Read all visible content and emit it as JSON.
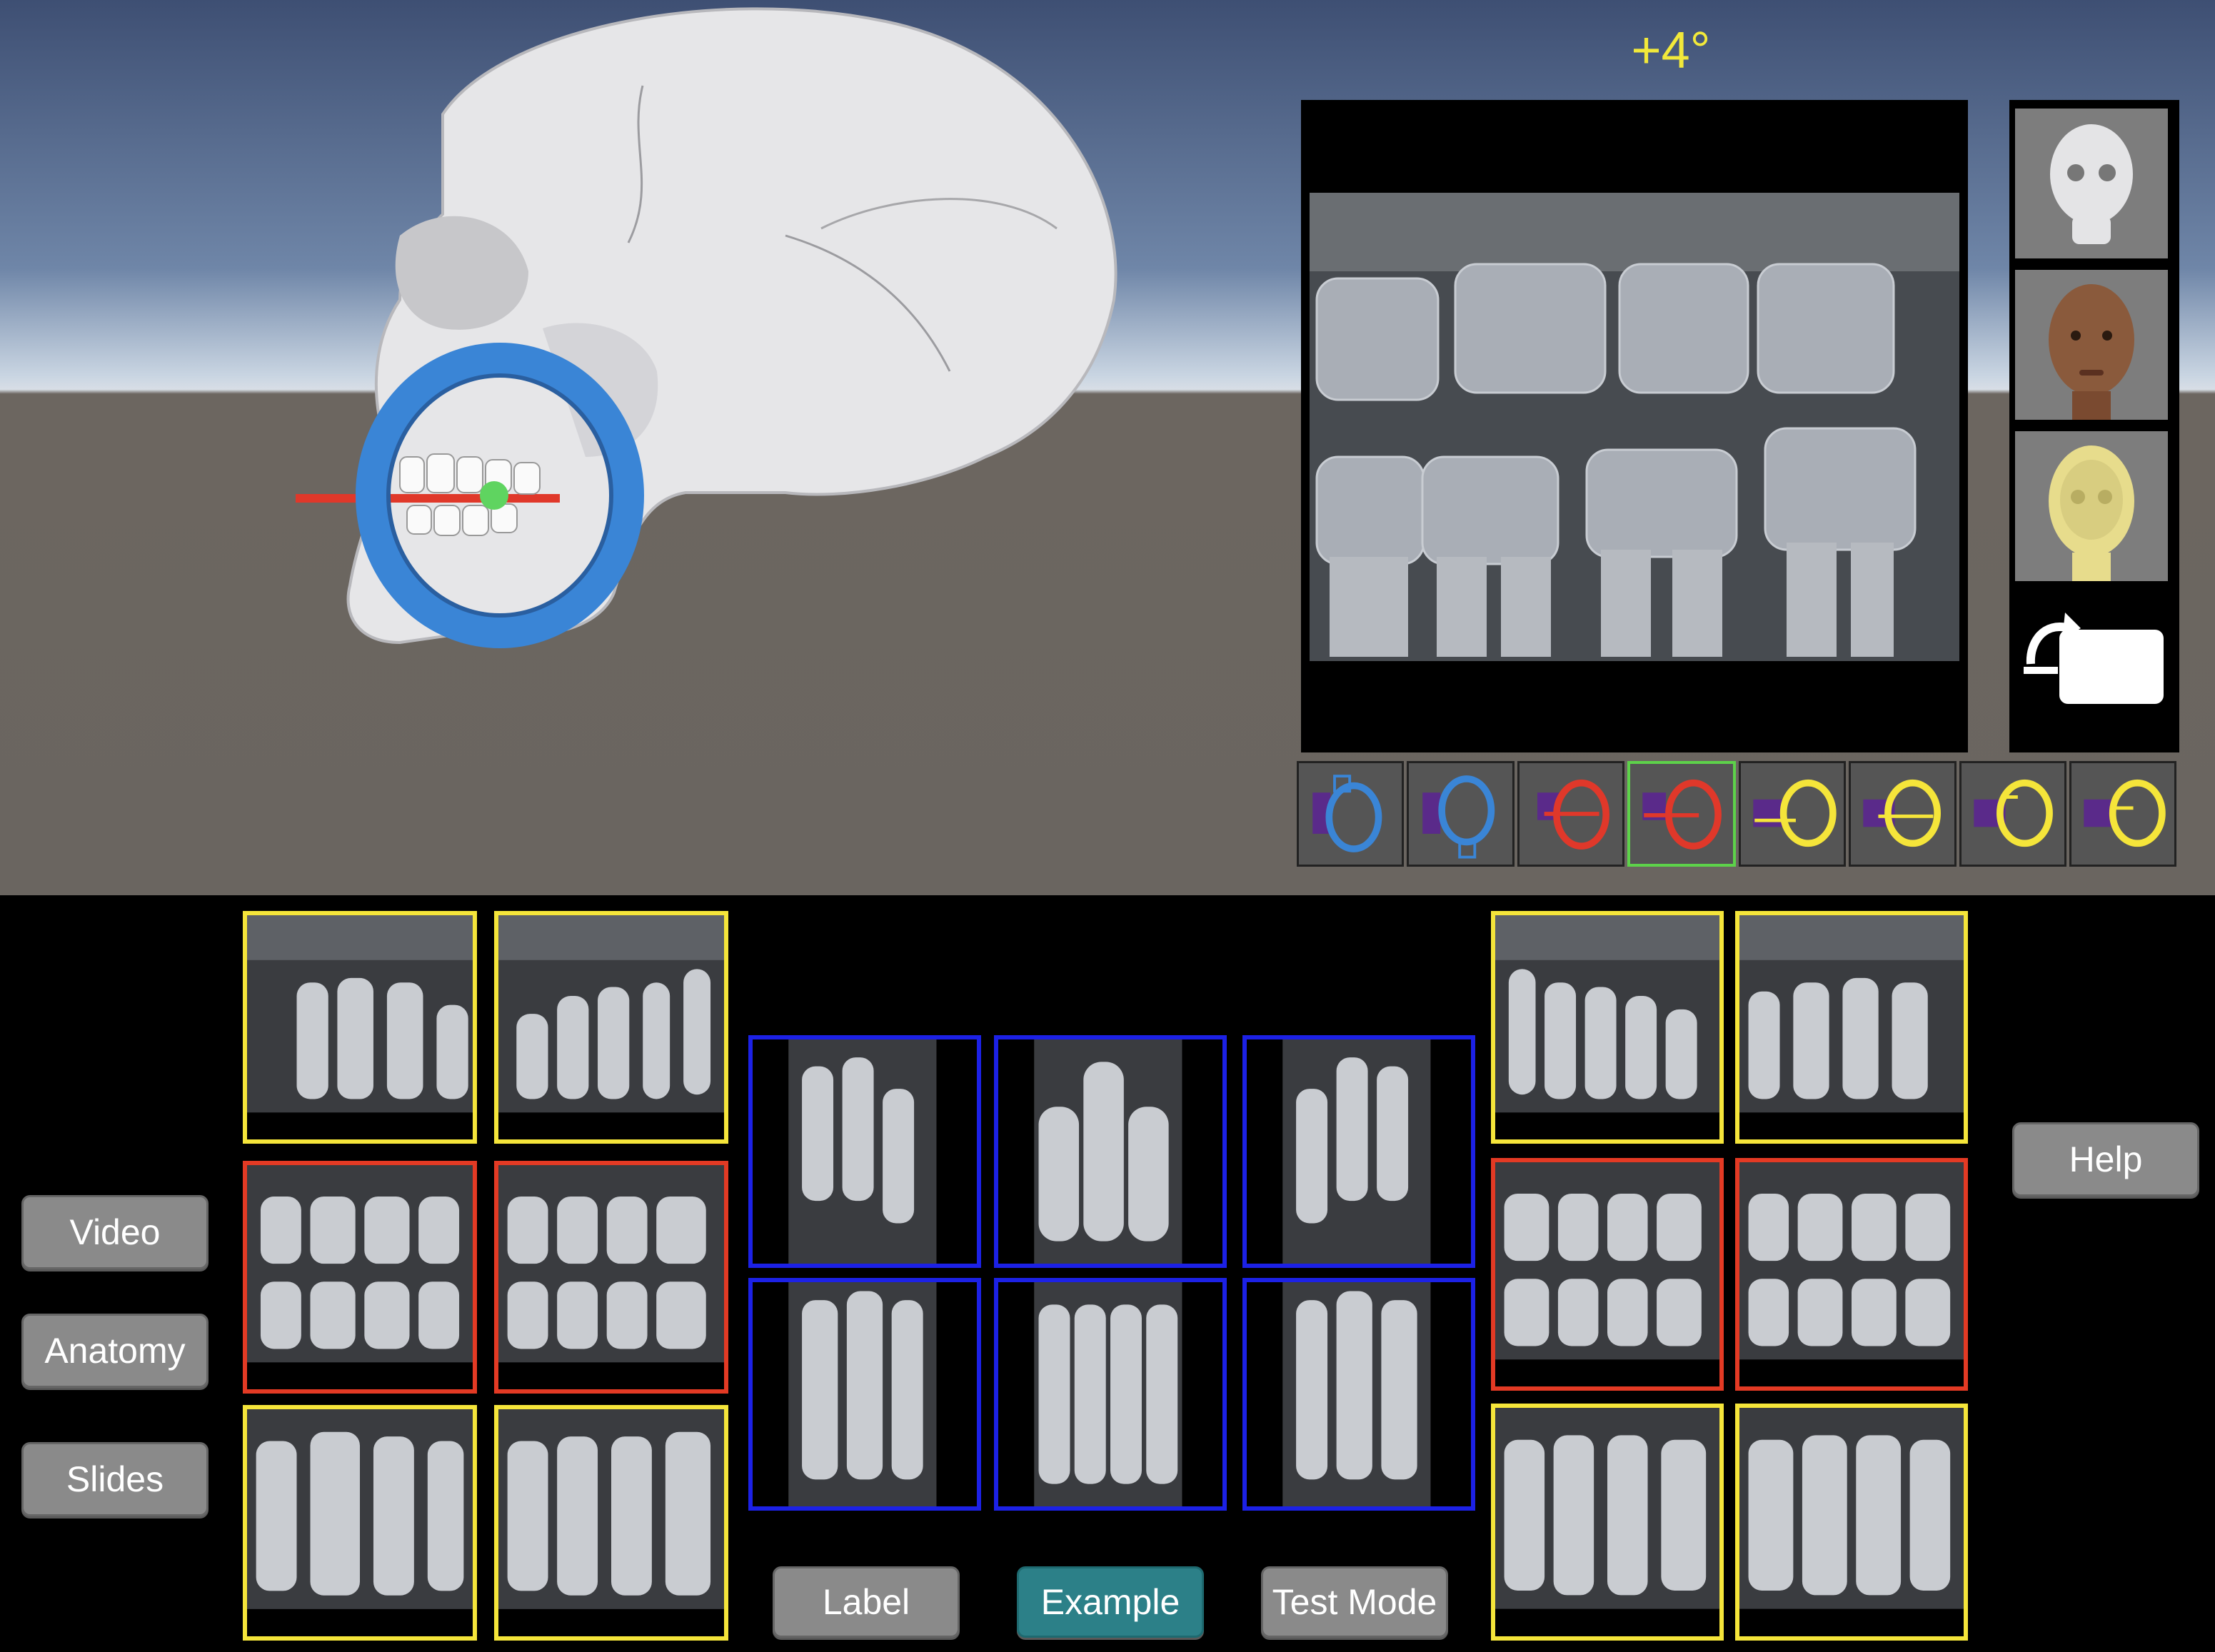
{
  "viewer": {
    "angle_label": "+4°",
    "scene_description_icons": [
      "skull-model",
      "positioning-ring-icon"
    ],
    "colors": {
      "ring": "#3a85d6",
      "ray": "#e0382a",
      "angle_text": "#f2e93a",
      "sky_top": "#3e4f73",
      "floor": "#6a6560"
    }
  },
  "side_panel": {
    "items": [
      "skull-view-icon",
      "head-skin-view-icon",
      "transparent-head-view-icon",
      "reset-view-icon"
    ]
  },
  "toolstrip": {
    "items": [
      {
        "icon": "blue-ring-left-icon",
        "color": "#3a85d6"
      },
      {
        "icon": "blue-ring-right-icon",
        "color": "#3a85d6"
      },
      {
        "icon": "red-ring-left-icon",
        "color": "#e0382a"
      },
      {
        "icon": "red-ring-right-icon",
        "color": "#e0382a",
        "active": true
      },
      {
        "icon": "yellow-ring-1-icon",
        "color": "#f5e53a"
      },
      {
        "icon": "yellow-ring-2-icon",
        "color": "#f5e53a"
      },
      {
        "icon": "yellow-ring-3-icon",
        "color": "#f5e53a"
      },
      {
        "icon": "yellow-ring-4-icon",
        "color": "#f5e53a"
      }
    ]
  },
  "left_menu": {
    "video": "Video",
    "anatomy": "Anatomy",
    "slides": "Slides"
  },
  "right_menu": {
    "help": "Help"
  },
  "bottom_menu": {
    "label": "Label",
    "example": "Example",
    "test_mode": "Test Mode"
  },
  "films": {
    "colors": {
      "posterior": "#f5e53a",
      "bitewing": "#e33a24",
      "anterior": "#1c21e6"
    }
  }
}
